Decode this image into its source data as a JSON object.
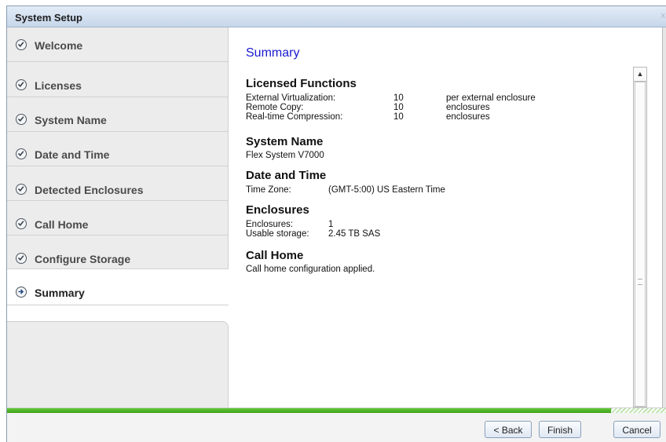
{
  "dialog": {
    "title": "System Setup",
    "close": "x"
  },
  "sidebar": {
    "items": [
      {
        "label": "Welcome",
        "icon": "check-circle-icon",
        "state": "done"
      },
      {
        "label": "Licenses",
        "icon": "check-circle-icon",
        "state": "done"
      },
      {
        "label": "System Name",
        "icon": "check-circle-icon",
        "state": "done"
      },
      {
        "label": "Date and Time",
        "icon": "check-circle-icon",
        "state": "done"
      },
      {
        "label": "Detected Enclosures",
        "icon": "check-circle-icon",
        "state": "done"
      },
      {
        "label": "Call Home",
        "icon": "check-circle-icon",
        "state": "done"
      },
      {
        "label": "Configure Storage",
        "icon": "check-circle-icon",
        "state": "done"
      },
      {
        "label": "Summary",
        "icon": "arrow-circle-icon",
        "state": "current"
      }
    ]
  },
  "summary": {
    "heading": "Summary",
    "licensed": {
      "title": "Licensed Functions",
      "rows": [
        {
          "name": "External Virtualization:",
          "value": "10",
          "unit": "per external enclosure"
        },
        {
          "name": "Remote Copy:",
          "value": "10",
          "unit": "enclosures"
        },
        {
          "name": "Real-time Compression:",
          "value": "10",
          "unit": "enclosures"
        }
      ]
    },
    "system_name": {
      "title": "System Name",
      "value": "Flex System V7000"
    },
    "date_time": {
      "title": "Date and Time",
      "label": "Time Zone:",
      "value": "(GMT-5:00) US Eastern Time"
    },
    "enclosures": {
      "title": "Enclosures",
      "rows": [
        {
          "label": "Enclosures:",
          "value": "1"
        },
        {
          "label": "Usable storage:",
          "value": "2.45 TB SAS"
        }
      ]
    },
    "call_home": {
      "title": "Call Home",
      "value": "Call home configuration applied."
    }
  },
  "progress": {
    "fraction": 0.915
  },
  "footer": {
    "back": "< Back",
    "finish": "Finish",
    "cancel": "Cancel"
  },
  "colors": {
    "progress": "#4cb52a",
    "heading": "#1a1ad0"
  }
}
